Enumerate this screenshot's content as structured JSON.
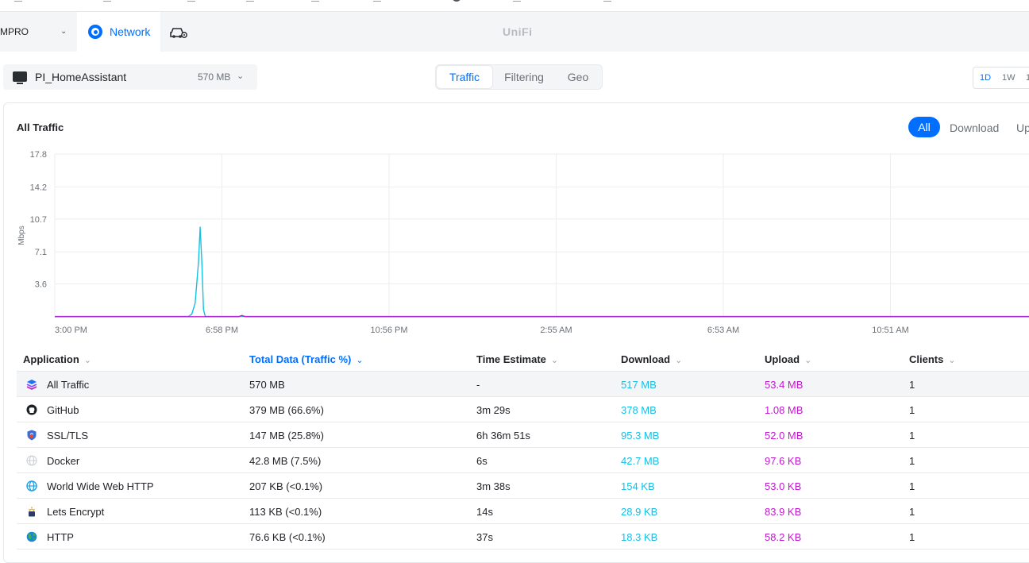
{
  "header": {
    "site_name": "MPRO",
    "nav_tab_label": "Network",
    "brand": "UniFi"
  },
  "device": {
    "name": "PI_HomeAssistant",
    "size": "570 MB"
  },
  "view_tabs": [
    "Traffic",
    "Filtering",
    "Geo"
  ],
  "view_tab_active": "Traffic",
  "periods": [
    "1D",
    "1W",
    "1"
  ],
  "period_active": "1D",
  "traffic": {
    "title": "All Traffic",
    "filters": [
      "All",
      "Download",
      "Up"
    ],
    "filter_active": "All"
  },
  "colors": {
    "accent": "#006fff",
    "download": "#13c1e6",
    "upload": "#c117cf"
  },
  "chart_data": {
    "type": "line",
    "title": "All Traffic",
    "ylabel": "Mbps",
    "xlabel": "",
    "ylim": [
      0,
      17.8
    ],
    "y_ticks": [
      "17.8",
      "14.2",
      "10.7",
      "7.1",
      "3.6"
    ],
    "x_ticks": [
      "3:00 PM",
      "6:58 PM",
      "10:56 PM",
      "2:55 AM",
      "6:53 AM",
      "10:51 AM"
    ],
    "grid": true,
    "series": [
      {
        "color": "#13c1e6",
        "points": [
          [
            0,
            0.05
          ],
          [
            0.8,
            0.05
          ],
          [
            0.82,
            0.3
          ],
          [
            0.84,
            1.5
          ],
          [
            0.86,
            6.0
          ],
          [
            0.87,
            9.8
          ],
          [
            0.88,
            6.0
          ],
          [
            0.89,
            0.8
          ],
          [
            0.9,
            0.05
          ],
          [
            5.9,
            0.05
          ],
          [
            5.94,
            0.7
          ],
          [
            5.98,
            0.05
          ],
          [
            6.1,
            0.05
          ]
        ]
      },
      {
        "color": "#c117cf",
        "points": [
          [
            0,
            0.02
          ],
          [
            1.1,
            0.02
          ],
          [
            1.12,
            0.15
          ],
          [
            1.14,
            0.02
          ],
          [
            6.1,
            0.02
          ]
        ]
      }
    ]
  },
  "table": {
    "columns": [
      "Application",
      "Total Data (Traffic %)",
      "Time Estimate",
      "Download",
      "Upload",
      "Clients"
    ],
    "active_column": "Total Data (Traffic %)",
    "rows": [
      {
        "icon": "layers-icon",
        "app": "All Traffic",
        "total": "570 MB",
        "time": "-",
        "download": "517 MB",
        "upload": "53.4 MB",
        "clients": "1"
      },
      {
        "icon": "github-icon",
        "app": "GitHub",
        "total": "379 MB (66.6%)",
        "time": "3m 29s",
        "download": "378 MB",
        "upload": "1.08 MB",
        "clients": "1"
      },
      {
        "icon": "shield-lock-icon",
        "app": "SSL/TLS",
        "total": "147 MB (25.8%)",
        "time": "6h 36m 51s",
        "download": "95.3 MB",
        "upload": "52.0 MB",
        "clients": "1"
      },
      {
        "icon": "globe-grey-icon",
        "app": "Docker",
        "total": "42.8 MB (7.5%)",
        "time": "6s",
        "download": "42.7 MB",
        "upload": "97.6 KB",
        "clients": "1"
      },
      {
        "icon": "www-globe-icon",
        "app": "World Wide Web HTTP",
        "total": "207 KB (<0.1%)",
        "time": "3m 38s",
        "download": "154 KB",
        "upload": "53.0 KB",
        "clients": "1"
      },
      {
        "icon": "lets-encrypt-icon",
        "app": "Lets Encrypt",
        "total": "113 KB (<0.1%)",
        "time": "14s",
        "download": "28.9 KB",
        "upload": "83.9 KB",
        "clients": "1"
      },
      {
        "icon": "earth-icon",
        "app": "HTTP",
        "total": "76.6 KB (<0.1%)",
        "time": "37s",
        "download": "18.3 KB",
        "upload": "58.2 KB",
        "clients": "1"
      }
    ]
  }
}
